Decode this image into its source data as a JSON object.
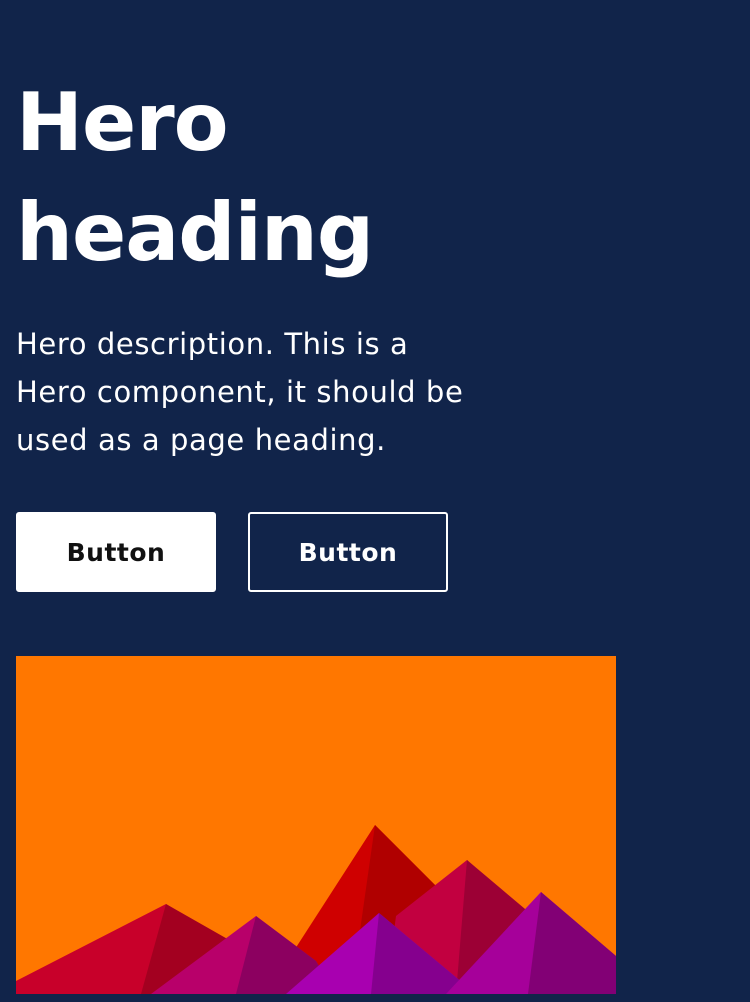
{
  "hero": {
    "heading": "Hero heading",
    "description": "Hero description. This is a Hero component, it should be used as a page heading.",
    "buttons": {
      "primary_label": "Button",
      "secondary_label": "Button"
    }
  },
  "colors": {
    "background": "#11244a",
    "image_sky": "#ff7700",
    "text": "#ffffff",
    "primary_button_bg": "#ffffff",
    "primary_button_text": "#111111"
  }
}
